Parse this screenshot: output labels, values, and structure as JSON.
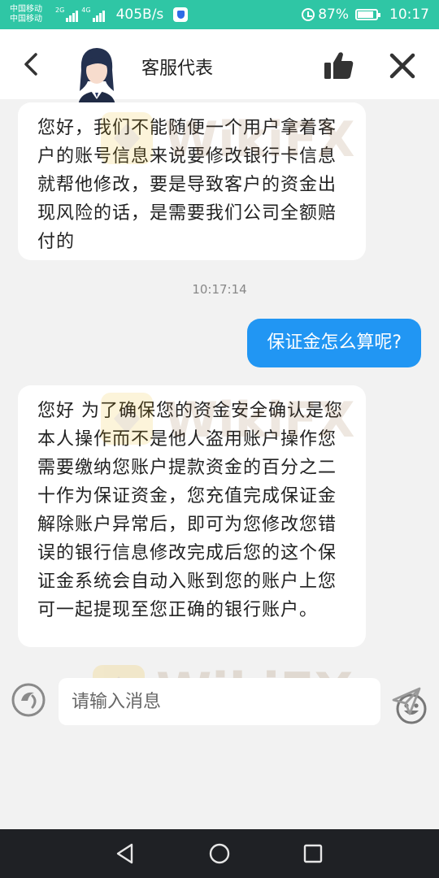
{
  "status_bar": {
    "carrier_1": "中国移动",
    "carrier_2": "中国移动",
    "net_1": "2G",
    "net_2": "4G",
    "speed": "405B/s",
    "battery": "87%",
    "battery_level": 0.87,
    "time": "10:17"
  },
  "header": {
    "title": "客服代表",
    "back_icon": "chevron-left-icon",
    "like_icon": "thumbs-up-icon",
    "close_icon": "close-icon"
  },
  "messages": [
    {
      "direction": "in",
      "text": "您好，我们不能随便一个用户拿着客户的账号信息来说要修改银行卡信息就帮他修改，要是导致客户的资金出现风险的话，是需要我们公司全额赔付的"
    },
    {
      "direction": "time",
      "text": "10:17:14"
    },
    {
      "direction": "out",
      "text": "保证金怎么算呢?"
    },
    {
      "direction": "in",
      "text": "您好 为了确保您的资金安全确认是您本人操作而不是他人盗用账户操作您需要缴纳您账户提款资金的百分之二十作为保证资金，您充值完成保证金解除账户异常后，即可为您修改您错误的银行信息修改完成后您的这个保证金系统会自动入账到您的账户上您可一起提现至您正确的银行账户。"
    }
  ],
  "input": {
    "placeholder": "请输入消息",
    "value": ""
  },
  "watermark": "WikiFX",
  "colors": {
    "status_bar": "#2fc6a5",
    "outgoing_bubble": "#2196f3",
    "background": "#f2f2f2",
    "nav_bar": "#1f2125"
  }
}
